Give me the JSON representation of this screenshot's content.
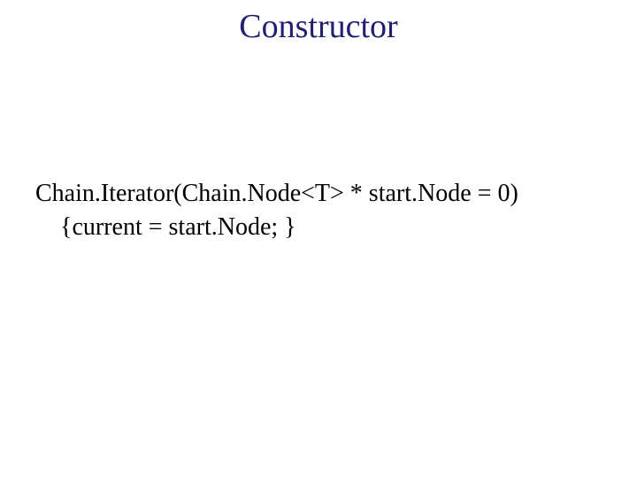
{
  "title": "Constructor",
  "code": {
    "line1": "Chain.Iterator(Chain.Node<T> * start.Node = 0)",
    "line2": "{current = start.Node; }"
  }
}
